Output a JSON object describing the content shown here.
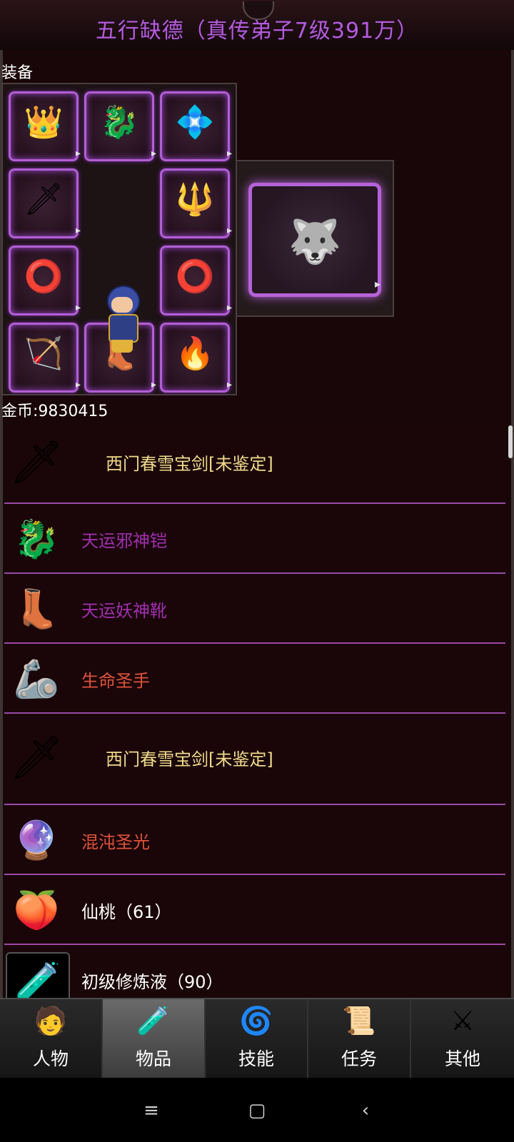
{
  "header": {
    "title": "五行缺德（真传弟子7级391万）"
  },
  "equipment": {
    "section_label": "装备",
    "slots": [
      {
        "icon": "helmet-icon",
        "glyph": "👑"
      },
      {
        "icon": "armor-icon",
        "glyph": "🐉"
      },
      {
        "icon": "necklace-icon",
        "glyph": "💠"
      },
      {
        "icon": "sword-icon",
        "glyph": "🗡"
      },
      {
        "icon": "staff-icon",
        "glyph": "🔱"
      },
      {
        "icon": "bracer-icon",
        "glyph": "⭕"
      },
      {
        "icon": "ring-icon",
        "glyph": "⭕"
      },
      {
        "icon": "bow-icon",
        "glyph": "🏹"
      },
      {
        "icon": "boots-icon",
        "glyph": "👢"
      },
      {
        "icon": "charm-icon",
        "glyph": "🔥"
      }
    ],
    "mount": {
      "icon": "black-beast-mount-icon",
      "glyph": "🐺"
    }
  },
  "gold_label": "金币:9830415",
  "items": [
    {
      "name": "西门春雪宝剑[未鉴定]",
      "color": "#f0dc8c",
      "icon": "sword-icon",
      "glyph": "🗡"
    },
    {
      "name": "天运邪神铠",
      "color": "#a02fb0",
      "icon": "armor-icon",
      "glyph": "🐉"
    },
    {
      "name": "天运妖神靴",
      "color": "#a02fb0",
      "icon": "boots-icon",
      "glyph": "👢"
    },
    {
      "name": "生命圣手",
      "color": "#e0523c",
      "icon": "bracer-icon",
      "glyph": "🦾"
    },
    {
      "name": "西门春雪宝剑[未鉴定]",
      "color": "#f0dc8c",
      "icon": "sword-icon",
      "glyph": "🗡"
    },
    {
      "name": "混沌圣光",
      "color": "#e0523c",
      "icon": "amulet-icon",
      "glyph": "🔮"
    },
    {
      "name": "仙桃（61）",
      "color": "#ffffff",
      "icon": "peach-icon",
      "glyph": "🍑"
    },
    {
      "name": "初级修炼液（90）",
      "color": "#ffffff",
      "icon": "potion-icon",
      "glyph": "🧪"
    }
  ],
  "tabs": [
    {
      "label": "人物",
      "icon": "character-icon",
      "glyph": "🧑"
    },
    {
      "label": "物品",
      "icon": "items-bottle-icon",
      "glyph": "🧪"
    },
    {
      "label": "技能",
      "icon": "skill-orb-icon",
      "glyph": "🌀"
    },
    {
      "label": "任务",
      "icon": "quest-icon",
      "glyph": "📜"
    },
    {
      "label": "其他",
      "icon": "other-icon",
      "glyph": "⚔"
    }
  ],
  "active_tab": "物品",
  "system_nav": {
    "menu": "≡",
    "home": "▢",
    "back": "‹"
  }
}
